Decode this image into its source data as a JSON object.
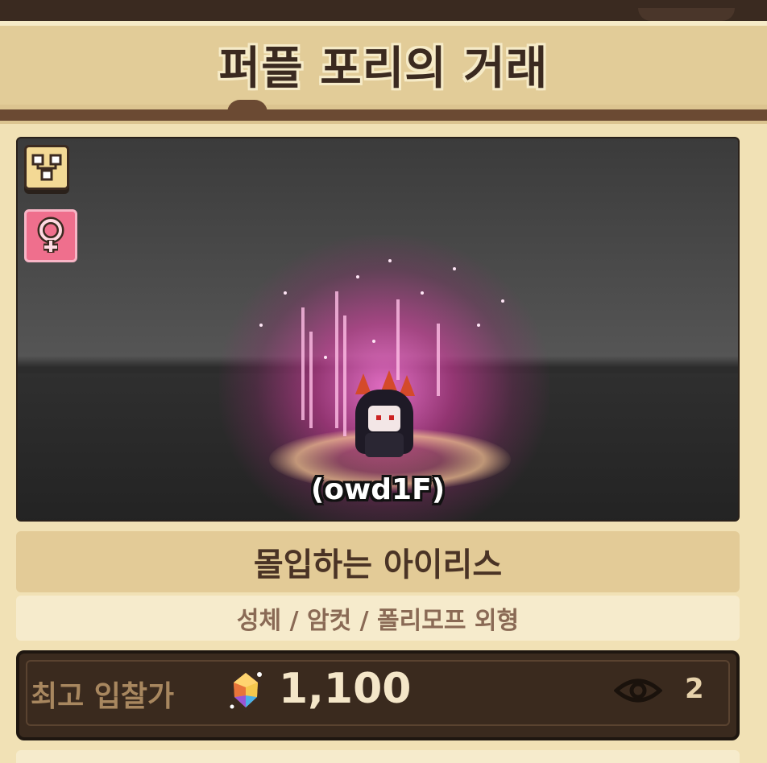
{
  "header": {
    "title": "퍼플 포리의 거래"
  },
  "stage": {
    "pet_name": "(owd1F)",
    "badges": [
      {
        "icon": "tree-icon",
        "color": "#f3d995"
      },
      {
        "icon": "female-icon",
        "color": "#ef6f8d"
      }
    ]
  },
  "pet": {
    "name": "몰입하는 아이리스",
    "traits": "성체 / 암컷 / 폴리모프 외형"
  },
  "bid": {
    "label": "최고 입찰가",
    "currency_icon": "gem-icon",
    "value": "1,100",
    "views_icon": "eye-icon",
    "views": "2"
  },
  "colors": {
    "background": "#f1e1b5",
    "title": "#3b2a20",
    "bid_panel": "#3a2a1e",
    "glow": "#e23ca8"
  }
}
